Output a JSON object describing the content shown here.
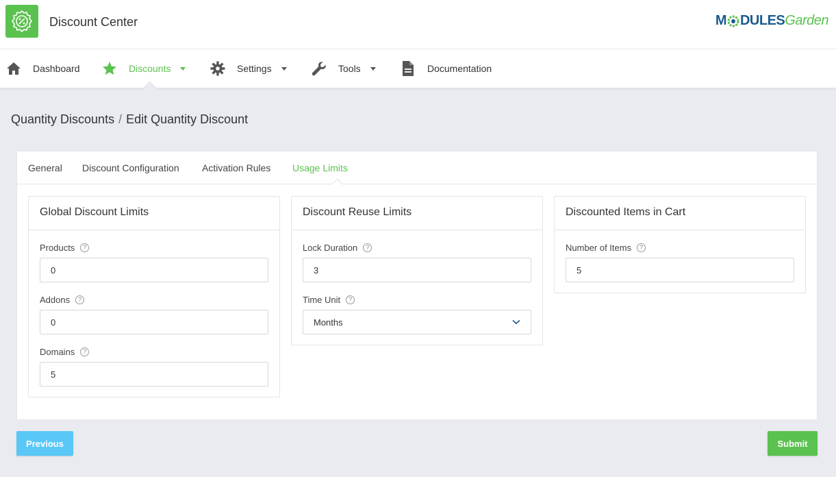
{
  "app": {
    "title": "Discount Center",
    "brand_part1": "M",
    "brand_part2": "DULES",
    "brand_part3": "Garden"
  },
  "nav": {
    "items": [
      {
        "label": "Dashboard"
      },
      {
        "label": "Discounts"
      },
      {
        "label": "Settings"
      },
      {
        "label": "Tools"
      },
      {
        "label": "Documentation"
      }
    ]
  },
  "breadcrumb": {
    "parent": "Quantity Discounts",
    "separator": "/",
    "current": "Edit Quantity Discount"
  },
  "tabs": [
    {
      "label": "General"
    },
    {
      "label": "Discount Configuration"
    },
    {
      "label": "Activation Rules"
    },
    {
      "label": "Usage Limits"
    }
  ],
  "panels": {
    "global": {
      "title": "Global Discount Limits",
      "products_label": "Products",
      "products_value": "0",
      "addons_label": "Addons",
      "addons_value": "0",
      "domains_label": "Domains",
      "domains_value": "5"
    },
    "reuse": {
      "title": "Discount Reuse Limits",
      "lock_label": "Lock Duration",
      "lock_value": "3",
      "unit_label": "Time Unit",
      "unit_value": "Months"
    },
    "cart": {
      "title": "Discounted Items in Cart",
      "items_label": "Number of Items",
      "items_value": "5"
    }
  },
  "help_glyph": "?",
  "buttons": {
    "previous": "Previous",
    "submit": "Submit"
  },
  "colors": {
    "accent": "#5bc14f",
    "info": "#5ac8f7",
    "brand_blue": "#1d5b8e"
  }
}
